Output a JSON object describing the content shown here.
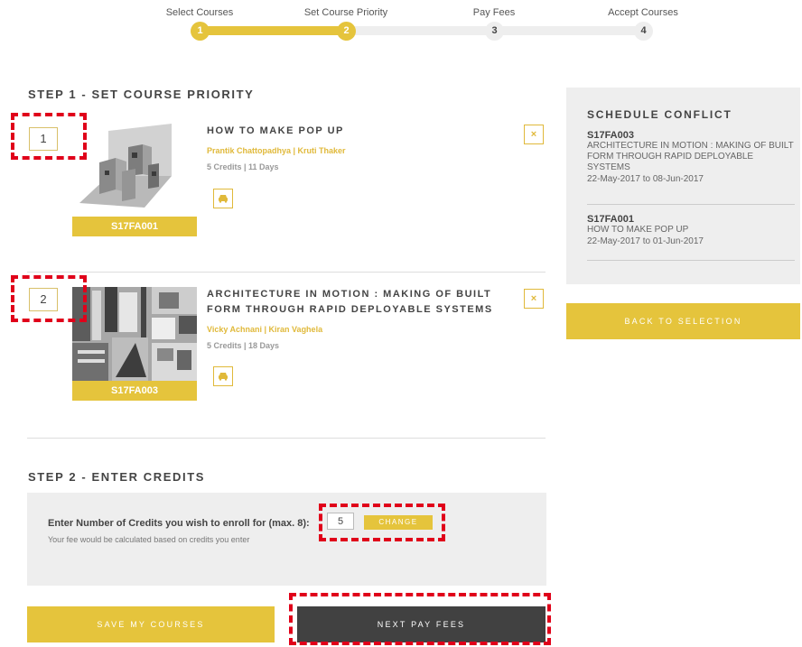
{
  "stepper": {
    "steps": [
      {
        "label": "Select Courses",
        "number": "1"
      },
      {
        "label": "Set Course Priority",
        "number": "2"
      },
      {
        "label": "Pay Fees",
        "number": "3"
      },
      {
        "label": "Accept Courses",
        "number": "4"
      }
    ],
    "current_step": 2
  },
  "step1": {
    "title": "STEP 1 - SET COURSE PRIORITY",
    "courses": [
      {
        "priority": "1",
        "code": "S17FA001",
        "title": "HOW TO MAKE POP UP",
        "authors": "Prantik Chattopadhya | Kruti Thaker",
        "meta": "5 Credits | 11 Days",
        "remove_label": "×"
      },
      {
        "priority": "2",
        "code": "S17FA003",
        "title": "ARCHITECTURE IN MOTION : MAKING OF BUILT FORM THROUGH RAPID DEPLOYABLE SYSTEMS",
        "authors": "Vicky Achnani | Kiran Vaghela",
        "meta": "5 Credits | 18 Days",
        "remove_label": "×"
      }
    ]
  },
  "sidebar": {
    "conflict_title": "SCHEDULE CONFLICT",
    "conflicts": [
      {
        "code": "S17FA003",
        "name": "ARCHITECTURE IN MOTION : MAKING OF BUILT FORM THROUGH RAPID DEPLOYABLE SYSTEMS",
        "dates": "22-May-2017 to 08-Jun-2017"
      },
      {
        "code": "S17FA001",
        "name": "HOW TO MAKE POP UP",
        "dates": "22-May-2017 to 01-Jun-2017"
      }
    ],
    "back_label": "BACK TO SELECTION"
  },
  "step2": {
    "title": "STEP 2 - ENTER CREDITS",
    "label": "Enter Number of Credits you wish to enroll for (max. 8):",
    "credits_value": "5",
    "change_label": "CHANGE",
    "help_text": "Your fee would be calculated based on credits you enter"
  },
  "footer": {
    "save_label": "SAVE MY COURSES",
    "next_label": "NEXT PAY FEES"
  },
  "colors": {
    "accent": "#e5c43c",
    "dark_button": "#414141",
    "panel_bg": "#eeeeee",
    "highlight": "#e0001a"
  }
}
